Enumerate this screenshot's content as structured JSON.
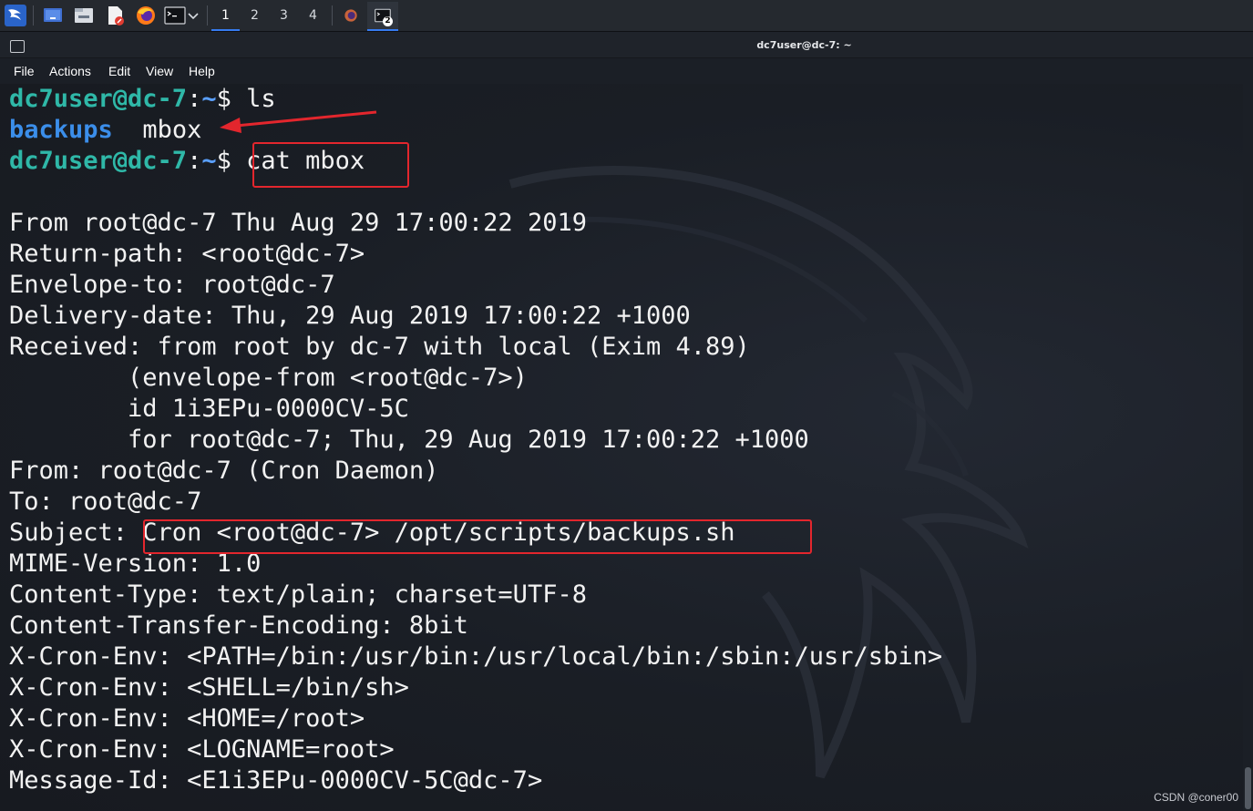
{
  "taskbar": {
    "workspaces": [
      "1",
      "2",
      "3",
      "4"
    ],
    "active_workspace": "1",
    "task_badge": "2",
    "icons": [
      "kali-menu-icon",
      "show-desktop-icon",
      "file-manager-icon",
      "text-editor-icon",
      "firefox-icon",
      "terminal-icon",
      "chevron-down-icon"
    ]
  },
  "window": {
    "title": "dc7user@dc-7: ~"
  },
  "menu": {
    "items": [
      "File",
      "Actions",
      "Edit",
      "View",
      "Help"
    ]
  },
  "terminal": {
    "prompt_user": "dc7user@dc-7",
    "prompt_sep": ":",
    "prompt_path": "~",
    "prompt_symbol": "$ ",
    "cmd1": "ls",
    "ls_dir": "backups",
    "ls_file": "mbox",
    "cmd2": "cat mbox",
    "output": [
      "From root@dc-7 Thu Aug 29 17:00:22 2019",
      "Return-path: <root@dc-7>",
      "Envelope-to: root@dc-7",
      "Delivery-date: Thu, 29 Aug 2019 17:00:22 +1000",
      "Received: from root by dc-7 with local (Exim 4.89)",
      "        (envelope-from <root@dc-7>)",
      "        id 1i3EPu-0000CV-5C",
      "        for root@dc-7; Thu, 29 Aug 2019 17:00:22 +1000",
      "From: root@dc-7 (Cron Daemon)",
      "To: root@dc-7",
      "Subject: Cron <root@dc-7> /opt/scripts/backups.sh",
      "MIME-Version: 1.0",
      "Content-Type: text/plain; charset=UTF-8",
      "Content-Transfer-Encoding: 8bit",
      "X-Cron-Env: <PATH=/bin:/usr/bin:/usr/local/bin:/sbin:/usr/sbin>",
      "X-Cron-Env: <SHELL=/bin/sh>",
      "X-Cron-Env: <HOME=/root>",
      "X-Cron-Env: <LOGNAME=root>",
      "Message-Id: <E1i3EPu-0000CV-5C@dc-7>"
    ]
  },
  "annotations": {
    "color": "#e3262d"
  },
  "watermark": "CSDN @coner00"
}
